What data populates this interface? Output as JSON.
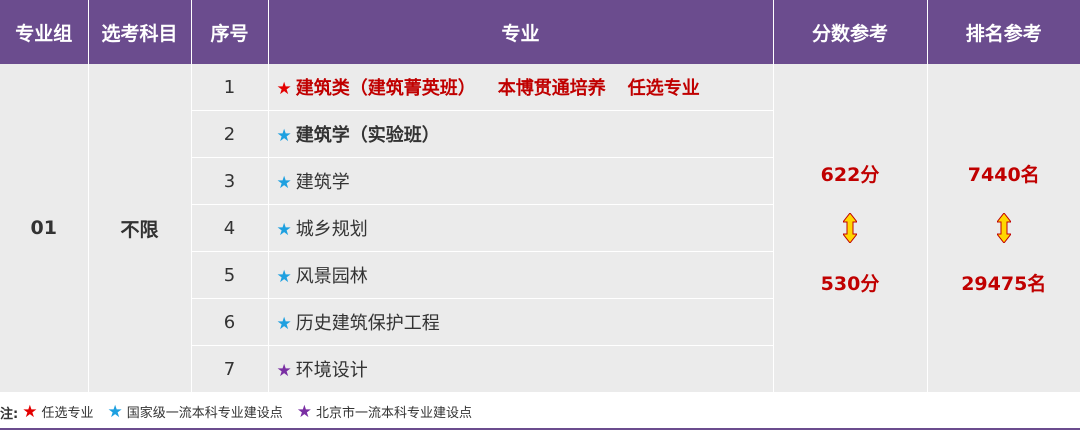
{
  "headers": [
    "专业组",
    "选考科目",
    "序号",
    "专业",
    "分数参考",
    "排名参考"
  ],
  "group": "01",
  "subject": "不限",
  "rows": [
    {
      "no": "1",
      "star": "★",
      "star_color": "#e30000",
      "style": "red",
      "parts": [
        "建筑类（建筑菁英班）",
        "本博贯通培养",
        "任选专业"
      ]
    },
    {
      "no": "2",
      "star": "★",
      "star_color": "#1ea0e0",
      "style": "bold",
      "name": "建筑学（实验班）"
    },
    {
      "no": "3",
      "star": "★",
      "star_color": "#1ea0e0",
      "style": "normal",
      "name": "建筑学"
    },
    {
      "no": "4",
      "star": "★",
      "star_color": "#1ea0e0",
      "style": "normal",
      "name": "城乡规划"
    },
    {
      "no": "5",
      "star": "★",
      "star_color": "#1ea0e0",
      "style": "normal",
      "name": "风景园林"
    },
    {
      "no": "6",
      "star": "★",
      "star_color": "#1ea0e0",
      "style": "normal",
      "name": "历史建筑保护工程"
    },
    {
      "no": "7",
      "star": "★",
      "star_color": "#7a2fa3",
      "style": "normal",
      "name": "环境设计"
    }
  ],
  "score": {
    "high": "622分",
    "low": "530分"
  },
  "rank": {
    "high": "7440名",
    "low": "29475名"
  },
  "arrow_icon": "double-arrow-icon",
  "colors": {
    "header_bg": "#6b4c8e",
    "cell_bg": "#ebebeb",
    "highlight": "#c00000",
    "arrow_fill": "#ffd700"
  },
  "note": {
    "label": "注:",
    "items": [
      {
        "star": "★",
        "star_color": "#e30000",
        "text": "任选专业"
      },
      {
        "star": "★",
        "star_color": "#1ea0e0",
        "text": "国家级一流本科专业建设点"
      },
      {
        "star": "★",
        "star_color": "#7a2fa3",
        "text": "北京市一流本科专业建设点"
      }
    ]
  }
}
